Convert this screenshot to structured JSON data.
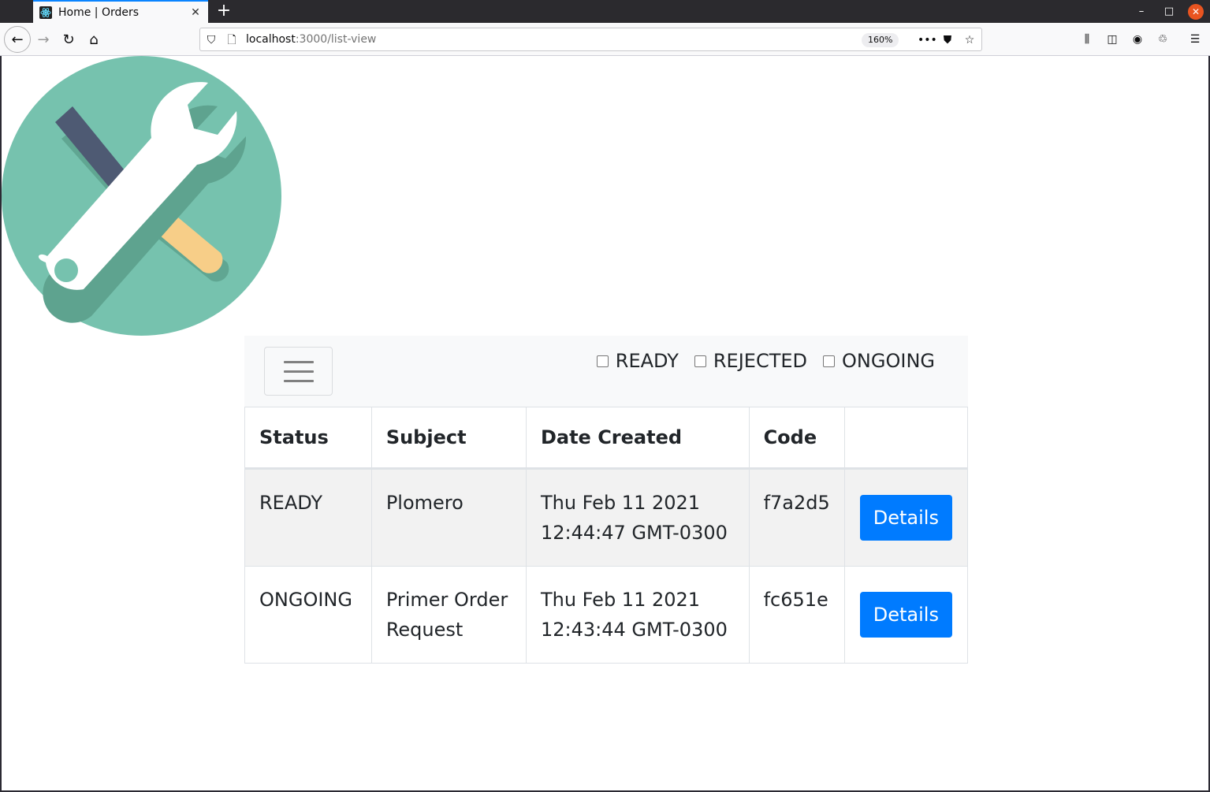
{
  "browser": {
    "tab_title": "Home | Orders",
    "url_host": "localhost",
    "url_path": ":3000/list-view",
    "zoom": "160%"
  },
  "filters": [
    {
      "label": "READY",
      "checked": false
    },
    {
      "label": "REJECTED",
      "checked": false
    },
    {
      "label": "ONGOING",
      "checked": false
    }
  ],
  "table": {
    "headers": [
      "Status",
      "Subject",
      "Date Created",
      "Code",
      ""
    ],
    "rows": [
      {
        "status": "READY",
        "subject": "Plomero",
        "date_line1": "Thu Feb 11 2021",
        "date_line2": "12:44:47 GMT-0300",
        "code": "f7a2d5",
        "action": "Details"
      },
      {
        "status": "ONGOING",
        "subject_line1": "Primer Order",
        "subject_line2": "Request",
        "date_line1": "Thu Feb 11 2021",
        "date_line2": "12:43:44 GMT-0300",
        "code": "fc651e",
        "action": "Details"
      }
    ]
  },
  "colors": {
    "logo_circle": "#76c2ae",
    "accent": "#007bff"
  }
}
